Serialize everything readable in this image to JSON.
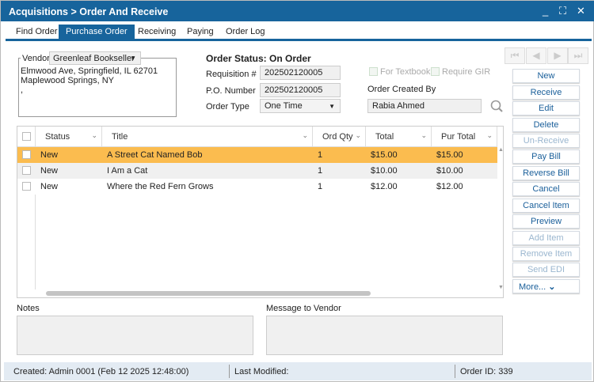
{
  "window": {
    "title": "Acquisitions > Order And Receive"
  },
  "tabs": [
    {
      "label": "Find Order"
    },
    {
      "label": "Purchase Order",
      "active": true
    },
    {
      "label": "Receiving"
    },
    {
      "label": "Paying"
    },
    {
      "label": "Order Log"
    }
  ],
  "vendor": {
    "label": "Vendor",
    "selected": "Greenleaf Bookseller",
    "address": [
      "Elmwood Ave, Springfield, IL 62701",
      "Maplewood Springs, NY",
      ","
    ]
  },
  "order": {
    "status_label": "Order Status: On Order",
    "requisition_label": "Requisition #",
    "requisition": "202502120005",
    "po_label": "P.O. Number",
    "po": "202502120005",
    "type_label": "Order Type",
    "type": "One Time",
    "for_textbook": "For Textbook",
    "require_gir": "Require GIR",
    "created_by_label": "Order Created By",
    "created_by": "Rabia Ahmed"
  },
  "buttons": [
    {
      "label": "New",
      "enabled": true
    },
    {
      "label": "Receive",
      "enabled": true
    },
    {
      "label": "Edit",
      "enabled": true
    },
    {
      "label": "Delete",
      "enabled": true
    },
    {
      "label": "Un-Receive",
      "enabled": false
    },
    {
      "label": "Pay Bill",
      "enabled": true
    },
    {
      "label": "Reverse Bill",
      "enabled": true
    },
    {
      "label": "Cancel",
      "enabled": true
    },
    {
      "label": "Cancel Item",
      "enabled": true
    },
    {
      "label": "Preview",
      "enabled": true
    },
    {
      "label": "Add Item",
      "enabled": false
    },
    {
      "label": "Remove Item",
      "enabled": false
    },
    {
      "label": "Send EDI",
      "enabled": false
    },
    {
      "label": "More...",
      "enabled": true
    }
  ],
  "grid": {
    "columns": [
      "Status",
      "Title",
      "Ord Qty",
      "Total",
      "Pur Total"
    ],
    "rows": [
      [
        "New",
        "A Street Cat Named Bob",
        "1",
        "$15.00",
        "$15.00"
      ],
      [
        "New",
        "I Am a Cat",
        "1",
        "$10.00",
        "$10.00"
      ],
      [
        "New",
        "Where the Red Fern Grows",
        "1",
        "$12.00",
        "$12.00"
      ]
    ],
    "selected_row": 0
  },
  "notes_label": "Notes",
  "message_label": "Message to Vendor",
  "status": {
    "created": "Created: Admin 0001 (Feb 12 2025 12:48:00)",
    "modified": "Last Modified:",
    "order_id": "Order ID: 339"
  },
  "colors": {
    "primary": "#17649c",
    "selected_row": "#fbbc4f"
  }
}
